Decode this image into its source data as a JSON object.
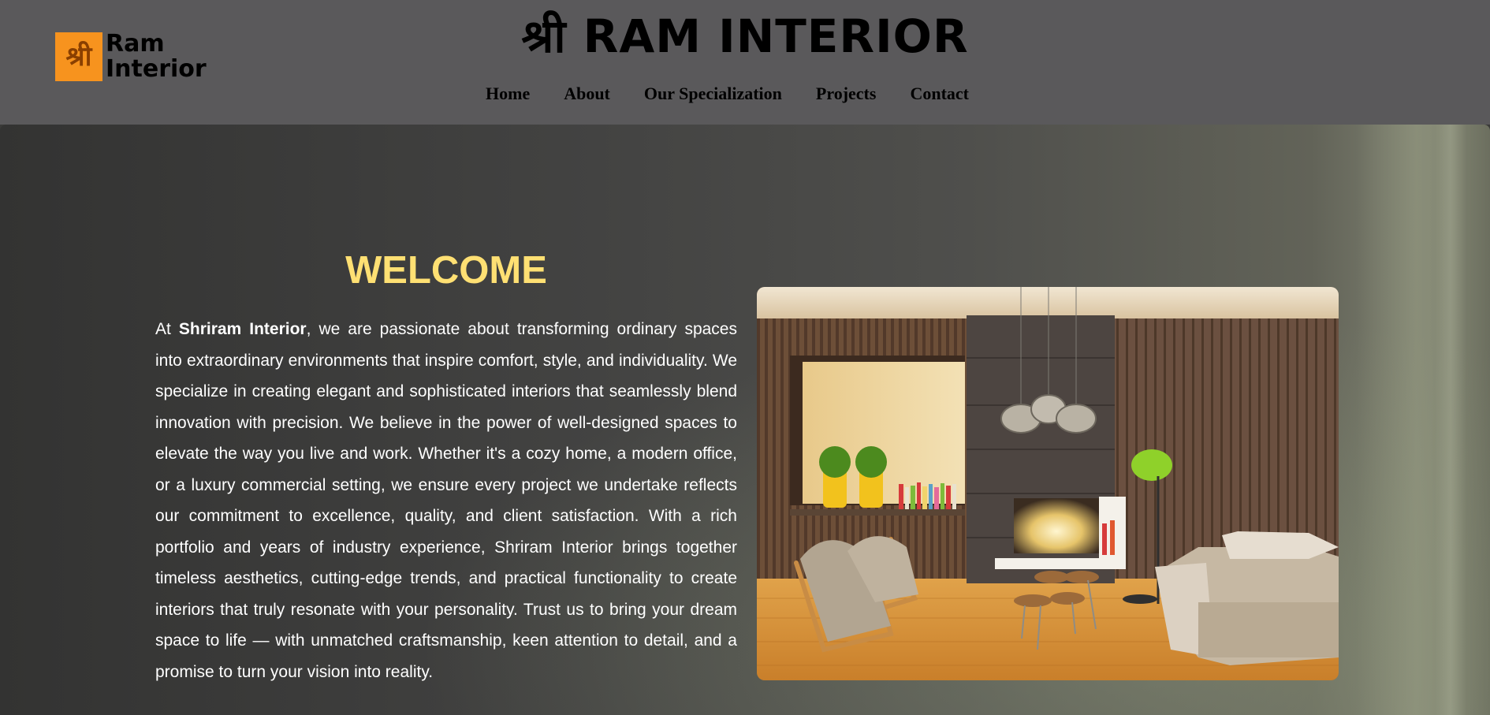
{
  "header": {
    "logo": {
      "symbol": "श्री",
      "line1": "Ram",
      "line2": "Interior",
      "accent": "#f7931e"
    },
    "title": "श्री RAM INTERIOR",
    "nav": [
      {
        "label": "Home"
      },
      {
        "label": "About"
      },
      {
        "label": "Our Specialization"
      },
      {
        "label": "Projects"
      },
      {
        "label": "Contact"
      }
    ],
    "background": "#5a595b"
  },
  "hero": {
    "heading": "WELCOME",
    "heading_color": "#ffe073",
    "intro_prefix": "At ",
    "intro_brand": "Shriram Interior",
    "intro_body": ", we are passionate about transforming ordinary spaces into extraordinary environments that inspire comfort, style, and individuality. We specialize in creating elegant and sophisticated interiors that seamlessly blend innovation with precision. We believe in the power of well-designed spaces to elevate the way you live and work. Whether it's a cozy home, a modern office, or a luxury commercial setting, we ensure every project we undertake reflects our commitment to excellence, quality, and client satisfaction. With a rich portfolio and years of industry experience, Shriram Interior brings together timeless aesthetics, cutting-edge trends, and practical functionality to create interiors that truly resonate with your personality. Trust us to bring your dream space to life — with unmatched craftsmanship, keen attention to detail, and a promise to turn your vision into reality.",
    "image": {
      "subject": "modern living room interior with wooden slat walls, fireplace, pendant lamps, lounge chairs and sofa"
    }
  }
}
